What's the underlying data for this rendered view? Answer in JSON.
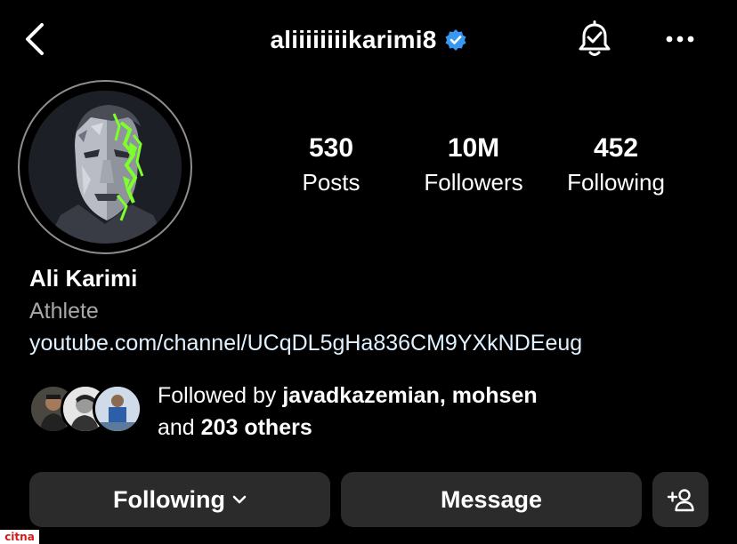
{
  "header": {
    "username": "aliiiiiiiikarimi8",
    "verified": true,
    "back_icon": "chevron-left-icon",
    "bell_icon": "bell-check-icon",
    "more_icon": "more-horizontal-icon"
  },
  "stats": [
    {
      "value": "530",
      "label": "Posts"
    },
    {
      "value": "10M",
      "label": "Followers"
    },
    {
      "value": "452",
      "label": "Following"
    }
  ],
  "profile": {
    "name": "Ali Karimi",
    "category": "Athlete",
    "link": "youtube.com/channel/UCqDL5gHa836CM9YXkNDEeug"
  },
  "followed_by": {
    "prefix": "Followed by ",
    "user1": "javadkazemian",
    "separator": ", ",
    "user2": "mohsen",
    "and_text": "and ",
    "others": "203 others"
  },
  "actions": {
    "following_label": "Following",
    "message_label": "Message",
    "suggest_icon": "add-person-icon"
  },
  "watermark": "citna",
  "colors": {
    "background": "#000000",
    "button_bg": "#2b2b2b",
    "verified_blue": "#3897f0",
    "secondary_text": "#a8a8a8",
    "avatar_accent": "#7cff2a"
  }
}
